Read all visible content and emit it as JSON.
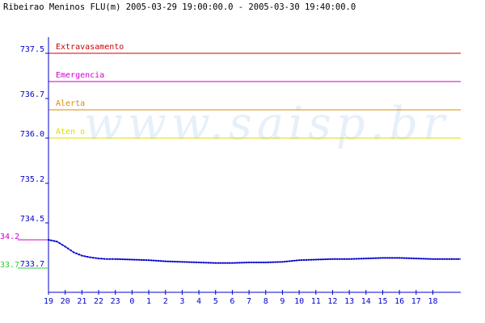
{
  "title": "Ribeirao Meninos FLU(m) 2005-03-29 19:00:00.0 - 2005-03-30 19:40:00.0",
  "watermark": "www.saisp.br",
  "colors": {
    "axis": "#0000cc",
    "series": "#0000cc",
    "watermark": "#e6f0fa",
    "current": "#cc00cc",
    "min": "#33cc33"
  },
  "chart_data": {
    "type": "line",
    "title": "Ribeirao Meninos FLU(m) 2005-03-29 19:00:00.0 - 2005-03-30 19:40:00.0",
    "xlabel": "",
    "ylabel": "",
    "ylim": [
      733.7,
      737.5
    ],
    "grid": false,
    "yticks": [
      "737.5",
      "736.7",
      "736.0",
      "735.2",
      "734.5",
      "733.7"
    ],
    "ytick_values": [
      737.5,
      736.7,
      736.0,
      735.2,
      734.5,
      733.7
    ],
    "xticks": [
      "19",
      "20",
      "21",
      "22",
      "23",
      "0",
      "1",
      "2",
      "3",
      "4",
      "5",
      "6",
      "7",
      "8",
      "9",
      "10",
      "11",
      "12",
      "13",
      "14",
      "15",
      "16",
      "17",
      "18"
    ],
    "xlim": [
      19,
      43.67
    ],
    "thresholds": [
      {
        "label": "Extravasamento",
        "value": 737.5,
        "color": "#cc0000"
      },
      {
        "label": "Emergencia",
        "value": 737.0,
        "color": "#cc00cc"
      },
      {
        "label": "Alerta",
        "value": 736.5,
        "color": "#dd8800"
      },
      {
        "label": "Aten  o",
        "value": 736.0,
        "color": "#dddd00"
      }
    ],
    "side_labels": [
      {
        "text": "34.2",
        "value": 734.2,
        "color": "#cc00cc"
      },
      {
        "text": "33.7",
        "value": 733.7,
        "color": "#33cc33"
      }
    ],
    "series": [
      {
        "x": [
          19.0,
          19.5,
          20.0,
          20.5,
          21.0,
          21.5,
          22.0,
          22.5,
          23.0,
          24.0,
          25.0,
          26.0,
          27.0,
          28.0,
          29.0,
          30.0,
          31.0,
          32.0,
          33.0,
          34.0,
          35.0,
          36.0,
          37.0,
          38.0,
          39.0,
          40.0,
          41.0,
          42.0,
          43.0,
          43.67
        ],
        "y": [
          734.2,
          734.17,
          734.08,
          733.98,
          733.92,
          733.89,
          733.87,
          733.86,
          733.86,
          733.85,
          733.84,
          733.82,
          733.81,
          733.8,
          733.79,
          733.79,
          733.8,
          733.8,
          733.81,
          733.84,
          733.85,
          733.86,
          733.86,
          733.87,
          733.88,
          733.88,
          733.87,
          733.86,
          733.86,
          733.86
        ]
      }
    ]
  }
}
